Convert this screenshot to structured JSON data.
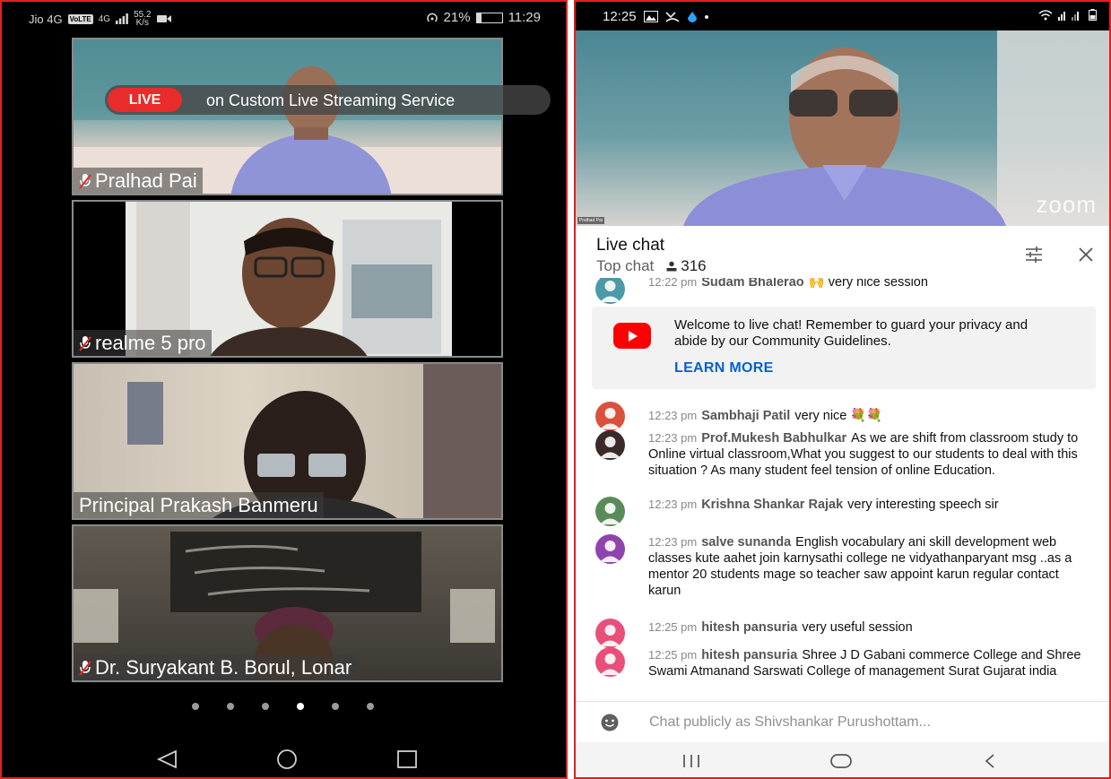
{
  "left_phone": {
    "status": {
      "carrier": "Jio 4G",
      "volte": "VoLTE",
      "net_type": "4G",
      "net_speed": "55.2",
      "net_speed_unit": "K/s",
      "battery": "21%",
      "battery_level": 0.21,
      "time": "11:29"
    },
    "live_banner": {
      "tag": "LIVE",
      "text": "on Custom Live Streaming Service"
    },
    "participants": [
      {
        "name": "Pralhad Pai",
        "muted": true
      },
      {
        "name": "realme 5 pro",
        "muted": true
      },
      {
        "name": "Principal Prakash  Banmeru",
        "muted": false
      },
      {
        "name": "Dr. Suryakant B. Borul, Lonar",
        "muted": true
      }
    ],
    "page_dots": {
      "count": 6,
      "active_index": 3
    },
    "nav_icons": [
      "back-icon",
      "home-icon",
      "recents-icon"
    ]
  },
  "right_phone": {
    "status": {
      "time": "12:25"
    },
    "video": {
      "tiny_name": "Pralhad Pai",
      "watermark": "zoom"
    },
    "chat": {
      "title": "Live chat",
      "mode": "Top chat",
      "viewers": "316",
      "welcome": {
        "text": "Welcome to live chat! Remember to guard your privacy and abide by our Community Guidelines.",
        "link": "LEARN MORE"
      },
      "messages": [
        {
          "time": "12:22 pm",
          "author": "Sudam Bhalerao",
          "text": "very nice session",
          "avatar_color": "#4a9aa8"
        },
        {
          "time": "12:23 pm",
          "author": "Sambhaji Patil",
          "text": "very nice 💐💐",
          "avatar_color": "#d9513c"
        },
        {
          "time": "12:23 pm",
          "author": "Prof.Mukesh Babhulkar",
          "text": "As we are shift from classroom study to Online virtual classroom,What you suggest to our students to deal with this situation ? As many student feel tension of online Education.",
          "avatar_color": "#3a2a2a"
        },
        {
          "time": "12:23 pm",
          "author": "Krishna Shankar Rajak",
          "text": "very interesting speech sir",
          "avatar_color": "#5a8c5a"
        },
        {
          "time": "12:23 pm",
          "author": "salve sunanda",
          "text": "English vocabulary ani skill development web classes kute aahet join karnysathi college ne vidyathanparyant msg ..as a mentor 20 students mage so teacher saw appoint karun regular contact karun",
          "avatar_color": "#8e44ad"
        },
        {
          "time": "12:25 pm",
          "author": "hitesh pansuria",
          "text": "very useful session",
          "avatar_color": "#e8507a"
        },
        {
          "time": "12:25 pm",
          "author": "hitesh pansuria",
          "text": "Shree J D Gabani commerce College and Shree Swami Atmanand Sarswati College of management Surat Gujarat india",
          "avatar_color": "#e8507a"
        }
      ],
      "input_placeholder": "Chat publicly as Shivshankar Purushottam..."
    },
    "nav_icons": [
      "recents-icon",
      "home-icon",
      "back-icon"
    ]
  },
  "colors": {
    "accent_red": "#e02020",
    "live_red": "#e82b2b",
    "link_blue": "#065fd4",
    "youtube_red": "#ff0000"
  }
}
